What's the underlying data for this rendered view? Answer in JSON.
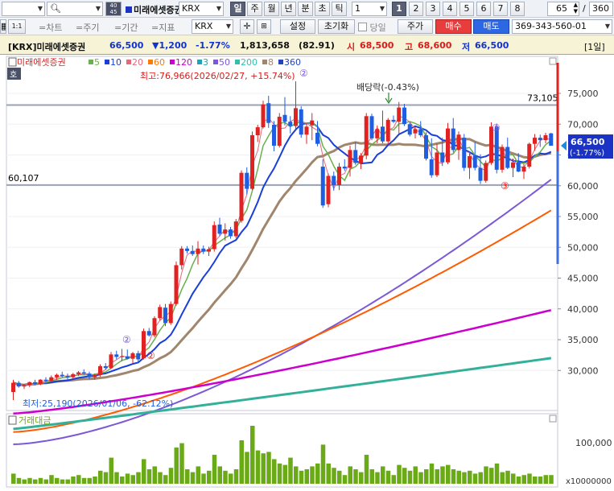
{
  "toolbar1": {
    "code_value": "",
    "period_badge_top": "40",
    "period_badge_bottom": "45",
    "stock_name": "미래에셋증권",
    "market": "KRX",
    "period_day": "일",
    "period_week": "주",
    "period_month": "월",
    "period_year": "년",
    "period_minute": "분",
    "period_second": "초",
    "period_tick": "틱",
    "interval_value": "1",
    "interval_buttons": [
      "1",
      "2",
      "3",
      "4",
      "5",
      "6",
      "7",
      "8"
    ],
    "view_count": "65",
    "total_count": "360",
    "slash": "/"
  },
  "toolbar2": {
    "row_num": "1:1",
    "tab_chart": "=차트",
    "tab_period": "=주기",
    "tab_duration": "=기간",
    "tab_indicator": "=지표",
    "settings": "설정",
    "reset": "초기화",
    "today_checkbox": "당일",
    "price_button": "주가",
    "buy_button": "매수",
    "sell_button": "매도",
    "account": "369-343-560-01"
  },
  "infobar": {
    "code": "[KRX]미래에셋증권",
    "price": "66,500",
    "change": "▼1,200",
    "change_pct": "-1.77%",
    "volume": "1,813,658",
    "volume_ratio": "(82.91)",
    "open_label": "시",
    "open": "68,500",
    "high_label": "고",
    "high": "68,600",
    "low_label": "저",
    "low": "66,500",
    "period_tag": "[1일]"
  },
  "legend": {
    "name": "미래에셋증권",
    "ma": [
      {
        "label": "5",
        "color": "#6ab04c"
      },
      {
        "label": "10",
        "color": "#1a3fd8"
      },
      {
        "label": "20",
        "color": "#e46a7a"
      },
      {
        "label": "60",
        "color": "#ff7a00"
      },
      {
        "label": "120",
        "color": "#cc00cc"
      },
      {
        "label": "3",
        "color": "#1ea4b8"
      },
      {
        "label": "50",
        "color": "#7b58d6"
      },
      {
        "label": "200",
        "color": "#33c0aa"
      },
      {
        "label": "8",
        "color": "#a0866c"
      },
      {
        "label": "360",
        "color": "#2244bb"
      }
    ]
  },
  "colors": {
    "up": "#e02222",
    "down": "#1f5ee0",
    "volume": "#6aaa16",
    "price_box": "#1a33c4",
    "ref_line": "#9aa3b3",
    "vol_line": "#3c6fe0"
  },
  "annotations": {
    "side_tag": "호",
    "high_note": "최고:76,966(2026/02/27, +15.74%)",
    "low_note": "최저:25,190(2026/01/06, -62.12%)",
    "dividend": "배당락(-0.43%)",
    "ref_high": "73,105",
    "ref_low": "60,107",
    "cur_price": "66,500",
    "cur_pct": "(-1.77%)",
    "vol_title": "거래대금",
    "vol_tick": "100,000",
    "vol_unit": "x10000000",
    "marker_2": "②",
    "marker_3": "③"
  },
  "chart_data": {
    "type": "candlestick",
    "y_ticks": [
      30000,
      35000,
      40000,
      45000,
      50000,
      55000,
      60000,
      65000,
      70000,
      75000
    ],
    "y_tick_labels": [
      "30,000",
      "35,000",
      "40,000",
      "45,000",
      "50,000",
      "55,000",
      "60,000",
      "65,000",
      "70,000",
      "75,000"
    ],
    "candles": [
      [
        26500,
        28500,
        25200,
        28000
      ],
      [
        28000,
        28300,
        27200,
        27400
      ],
      [
        27400,
        27800,
        27000,
        27600
      ],
      [
        27600,
        28200,
        27300,
        28100
      ],
      [
        28100,
        28500,
        27600,
        27800
      ],
      [
        27800,
        28600,
        27600,
        28500
      ],
      [
        28500,
        28900,
        28000,
        28300
      ],
      [
        28300,
        29200,
        28100,
        28900
      ],
      [
        28900,
        29500,
        28500,
        29300
      ],
      [
        29300,
        29800,
        28900,
        29100
      ],
      [
        29100,
        29500,
        28500,
        28900
      ],
      [
        28900,
        29600,
        28700,
        29400
      ],
      [
        29400,
        29900,
        29100,
        29700
      ],
      [
        29700,
        30200,
        29300,
        29500
      ],
      [
        29500,
        29800,
        28600,
        28900
      ],
      [
        28900,
        29500,
        28500,
        29300
      ],
      [
        29300,
        31000,
        29000,
        30700
      ],
      [
        30700,
        31200,
        30100,
        30400
      ],
      [
        30400,
        33000,
        30200,
        32600
      ],
      [
        32600,
        33200,
        31800,
        32200
      ],
      [
        32200,
        33500,
        31500,
        32300
      ],
      [
        32300,
        33400,
        31800,
        31900
      ],
      [
        31900,
        33000,
        31200,
        32800
      ],
      [
        32800,
        33200,
        31300,
        31800
      ],
      [
        32000,
        36800,
        31800,
        36400
      ],
      [
        36400,
        36900,
        35500,
        35700
      ],
      [
        35700,
        38800,
        35400,
        38500
      ],
      [
        38500,
        40700,
        38100,
        40300
      ],
      [
        40200,
        40800,
        37200,
        37700
      ],
      [
        37700,
        41200,
        37400,
        40800
      ],
      [
        40800,
        47700,
        40500,
        47100
      ],
      [
        47100,
        50200,
        46400,
        49800
      ],
      [
        49800,
        50200,
        49000,
        49400
      ],
      [
        49400,
        50300,
        48600,
        48900
      ],
      [
        48900,
        51000,
        47200,
        49800
      ],
      [
        49800,
        50300,
        48900,
        49300
      ],
      [
        49300,
        50100,
        48600,
        49700
      ],
      [
        49700,
        54200,
        49300,
        53600
      ],
      [
        53700,
        54800,
        51800,
        52200
      ],
      [
        52200,
        53900,
        51100,
        52900
      ],
      [
        52900,
        53300,
        51400,
        51800
      ],
      [
        51800,
        54600,
        51500,
        54200
      ],
      [
        54300,
        62500,
        54000,
        62100
      ],
      [
        62100,
        63000,
        58600,
        59500
      ],
      [
        59500,
        68800,
        59300,
        68200
      ],
      [
        68200,
        69900,
        67100,
        69500
      ],
      [
        69500,
        73800,
        69300,
        73200
      ],
      [
        73400,
        74600,
        69400,
        70200
      ],
      [
        69900,
        70500,
        65600,
        66500
      ],
      [
        66500,
        71800,
        66200,
        71200
      ],
      [
        71500,
        74400,
        69800,
        70400
      ],
      [
        70400,
        71300,
        68500,
        69700
      ],
      [
        69700,
        76966,
        69200,
        72600
      ],
      [
        72400,
        72900,
        67800,
        68300
      ],
      [
        68300,
        70200,
        66800,
        69600
      ],
      [
        69800,
        71800,
        67400,
        70600
      ],
      [
        68600,
        70500,
        66400,
        66800
      ],
      [
        63100,
        64300,
        56400,
        56800
      ],
      [
        57000,
        62000,
        56500,
        61600
      ],
      [
        61600,
        62300,
        59200,
        60100
      ],
      [
        60100,
        63700,
        59300,
        63100
      ],
      [
        63100,
        64300,
        62400,
        62800
      ],
      [
        62900,
        66500,
        61500,
        65800
      ],
      [
        65800,
        67100,
        63400,
        63700
      ],
      [
        63700,
        65300,
        62700,
        64900
      ],
      [
        64900,
        71800,
        64300,
        71300
      ],
      [
        71300,
        71700,
        67400,
        67700
      ],
      [
        67700,
        69800,
        66900,
        69200
      ],
      [
        69600,
        72200,
        66900,
        67200
      ],
      [
        67200,
        71000,
        66800,
        70700
      ],
      [
        70700,
        71400,
        70200,
        70400
      ],
      [
        70400,
        73600,
        68500,
        72700
      ],
      [
        72700,
        73300,
        69700,
        70000
      ],
      [
        70000,
        70300,
        68000,
        68300
      ],
      [
        68500,
        69600,
        67700,
        69200
      ],
      [
        69200,
        70500,
        67900,
        68200
      ],
      [
        68200,
        68700,
        64100,
        64400
      ],
      [
        64300,
        67700,
        61300,
        61700
      ],
      [
        61700,
        66800,
        61400,
        65400
      ],
      [
        65400,
        67800,
        63200,
        63800
      ],
      [
        63800,
        70200,
        63500,
        69300
      ],
      [
        69300,
        71000,
        65400,
        65800
      ],
      [
        65800,
        68800,
        64200,
        68300
      ],
      [
        67800,
        68400,
        62400,
        62900
      ],
      [
        62900,
        65300,
        61100,
        64800
      ],
      [
        64900,
        67100,
        62500,
        62900
      ],
      [
        62900,
        65100,
        60300,
        60800
      ],
      [
        60800,
        64100,
        60500,
        63700
      ],
      [
        63700,
        70300,
        63400,
        69600
      ],
      [
        69600,
        70100,
        62000,
        62600
      ],
      [
        62600,
        66700,
        62100,
        66300
      ],
      [
        66300,
        67800,
        62700,
        62900
      ],
      [
        62900,
        64400,
        61400,
        63800
      ],
      [
        63800,
        65300,
        62200,
        62300
      ],
      [
        62300,
        63600,
        61100,
        63100
      ],
      [
        63100,
        67000,
        62800,
        66800
      ],
      [
        66800,
        68400,
        65700,
        67800
      ],
      [
        67800,
        68300,
        66300,
        67400
      ],
      [
        67400,
        68600,
        66900,
        68200
      ],
      [
        68500,
        68600,
        66500,
        66500
      ]
    ],
    "volume": [
      7,
      4,
      3,
      4,
      3,
      4,
      3,
      6,
      4,
      3,
      3,
      5,
      6,
      4,
      4,
      5,
      9,
      8,
      18,
      8,
      5,
      7,
      6,
      8,
      17,
      10,
      12,
      8,
      6,
      11,
      25,
      28,
      10,
      8,
      12,
      7,
      9,
      20,
      12,
      9,
      7,
      10,
      30,
      22,
      40,
      23,
      21,
      22,
      17,
      14,
      13,
      18,
      12,
      9,
      10,
      12,
      14,
      27,
      14,
      11,
      9,
      6,
      12,
      10,
      8,
      20,
      10,
      8,
      12,
      9,
      6,
      13,
      11,
      9,
      12,
      8,
      10,
      14,
      10,
      12,
      13,
      10,
      9,
      8,
      9,
      7,
      8,
      12,
      11,
      14,
      8,
      9,
      7,
      5,
      6,
      7,
      5,
      5,
      6,
      6
    ]
  }
}
